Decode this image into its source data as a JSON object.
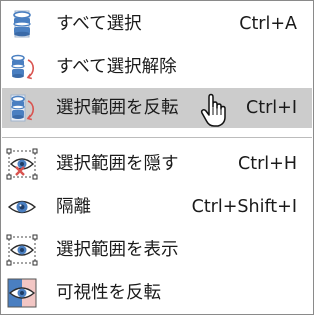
{
  "menu": {
    "items": [
      {
        "label": "すべて選択",
        "shortcut": "Ctrl+A",
        "icon": "select-all-icon"
      },
      {
        "label": "すべて選択解除",
        "shortcut": "",
        "icon": "deselect-all-icon"
      },
      {
        "label": "選択範囲を反転",
        "shortcut": "Ctrl+I",
        "icon": "invert-selection-icon",
        "highlighted": true
      },
      {
        "label": "選択範囲を隠す",
        "shortcut": "Ctrl+H",
        "icon": "hide-selection-icon"
      },
      {
        "label": "隔離",
        "shortcut": "Ctrl+Shift+I",
        "icon": "isolate-icon"
      },
      {
        "label": "選択範囲を表示",
        "shortcut": "",
        "icon": "show-selection-icon"
      },
      {
        "label": "可視性を反転",
        "shortcut": "",
        "icon": "invert-visibility-icon"
      }
    ]
  },
  "colors": {
    "highlight": "#cccccc",
    "icon_blue": "#4a7fc1",
    "icon_red": "#d9534f"
  }
}
